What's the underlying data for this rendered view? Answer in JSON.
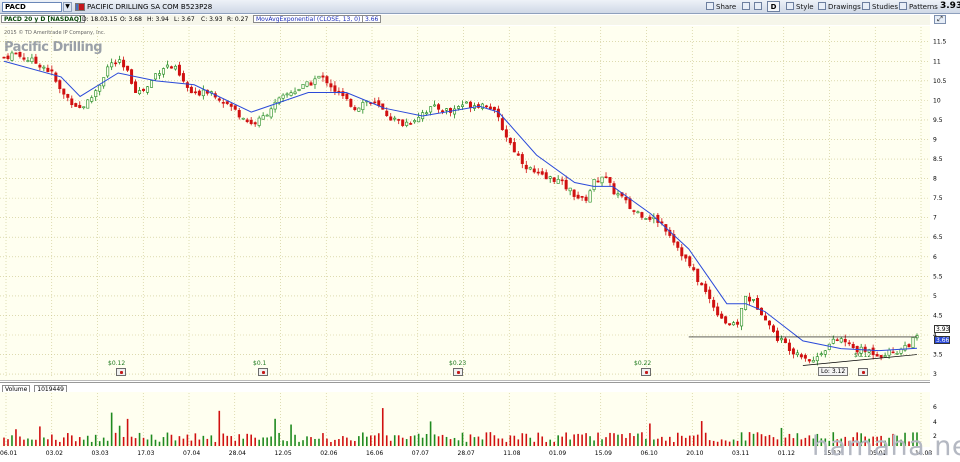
{
  "toolbar": {
    "symbol": "PACD",
    "dropdown_glyph": "▼",
    "description": "PACIFIC DRILLING SA COM  B523P28",
    "share": "Share",
    "d_button": "D",
    "style": "Style",
    "drawings": "Drawings",
    "studies": "Studies",
    "patterns": "Patterns",
    "last_price": "3.93",
    "icons": [
      "blue-square-icon",
      "red-square-icon",
      "share-icon",
      "grid-icon",
      "camera-icon",
      "style-icon",
      "drawings-icon",
      "studies-icon",
      "patterns-icon",
      "zoom-icon"
    ]
  },
  "quote": {
    "title": "PACD 20 y D [NASDAQ]",
    "date": "D: 18.03.15",
    "open": "O: 3.68",
    "high": "H: 3.94",
    "low": "L: 3.67",
    "close": "C: 3.93",
    "range": "R: 0.27",
    "study": "MovAvgExponential (CLOSE, 13, 0)",
    "study_value": "3.66"
  },
  "chart": {
    "copyright": "2015 © TD Ameritrade IP Company, Inc.",
    "logo": "Pacific Drilling",
    "low_label": "Lo: 3.12",
    "price_tag": "3.93",
    "ema_tag": "3.66",
    "colors": {
      "up": "#1f8a1f",
      "down": "#d01010",
      "ema": "#2b4ad9",
      "grid": "#c9c58a",
      "bg": "#fffff0"
    },
    "dividends": [
      {
        "label": "$0.12"
      },
      {
        "label": "$0.1"
      },
      {
        "label": "$0.23"
      },
      {
        "label": "$0.22"
      },
      {
        "label": "$0.12"
      }
    ]
  },
  "volume": {
    "title": "Volume",
    "value": "1019449",
    "scale": [
      "6",
      "4",
      "2"
    ]
  },
  "watermark": "hamaha.net",
  "chart_data": {
    "type": "candlestick",
    "title": "PACD 20 y D [NASDAQ]",
    "ylim": [
      2.9,
      11.8
    ],
    "y_ticks": [
      "11.5",
      "11",
      "10.5",
      "10",
      "9.5",
      "9",
      "8.5",
      "8",
      "7.5",
      "7",
      "6.5",
      "6",
      "5.5",
      "5",
      "4.5",
      "4",
      "3.5",
      "3"
    ],
    "x_ticks": [
      "06.01",
      "03.02",
      "03.03",
      "17.03",
      "07.04",
      "28.04",
      "12.05",
      "02.06",
      "16.06",
      "07.07",
      "28.07",
      "11.08",
      "01.09",
      "15.09",
      "06.10",
      "20.10",
      "03.11",
      "01.12",
      "15.12",
      "05.01",
      "16.03"
    ],
    "close_path": [
      [
        0,
        11.1
      ],
      [
        5,
        11.2
      ],
      [
        10,
        11.1
      ],
      [
        15,
        11.0
      ],
      [
        20,
        10.9
      ],
      [
        25,
        10.7
      ],
      [
        30,
        10.2
      ],
      [
        35,
        10.0
      ],
      [
        40,
        9.8
      ],
      [
        45,
        10.0
      ],
      [
        50,
        10.4
      ],
      [
        55,
        10.9
      ],
      [
        60,
        11.0
      ],
      [
        65,
        10.7
      ],
      [
        70,
        10.2
      ],
      [
        75,
        10.3
      ],
      [
        80,
        10.7
      ],
      [
        85,
        10.9
      ],
      [
        90,
        10.8
      ],
      [
        95,
        10.4
      ],
      [
        100,
        10.1
      ],
      [
        105,
        10.3
      ],
      [
        110,
        10.2
      ],
      [
        115,
        10.0
      ],
      [
        120,
        9.8
      ],
      [
        125,
        9.6
      ],
      [
        130,
        9.4
      ],
      [
        135,
        9.5
      ],
      [
        140,
        9.8
      ],
      [
        145,
        10.0
      ],
      [
        150,
        10.2
      ],
      [
        155,
        10.3
      ],
      [
        160,
        10.4
      ],
      [
        165,
        10.6
      ],
      [
        170,
        10.5
      ],
      [
        175,
        10.2
      ],
      [
        180,
        10.0
      ],
      [
        185,
        9.8
      ],
      [
        190,
        10.0
      ],
      [
        195,
        9.9
      ],
      [
        200,
        9.7
      ],
      [
        205,
        9.5
      ],
      [
        210,
        9.4
      ],
      [
        215,
        9.5
      ],
      [
        220,
        9.7
      ],
      [
        225,
        9.8
      ],
      [
        230,
        9.8
      ],
      [
        235,
        9.7
      ],
      [
        240,
        9.9
      ],
      [
        245,
        9.9
      ],
      [
        250,
        9.9
      ],
      [
        255,
        9.9
      ],
      [
        260,
        9.5
      ],
      [
        265,
        9.0
      ],
      [
        270,
        8.6
      ],
      [
        275,
        8.3
      ],
      [
        280,
        8.1
      ],
      [
        285,
        8.0
      ],
      [
        290,
        8.0
      ],
      [
        295,
        7.8
      ],
      [
        300,
        7.6
      ],
      [
        305,
        7.4
      ],
      [
        310,
        7.9
      ],
      [
        315,
        8.1
      ],
      [
        320,
        7.7
      ],
      [
        325,
        7.5
      ],
      [
        330,
        7.2
      ],
      [
        335,
        7.1
      ],
      [
        340,
        7.0
      ],
      [
        345,
        6.9
      ],
      [
        350,
        6.6
      ],
      [
        355,
        6.2
      ],
      [
        360,
        5.8
      ],
      [
        365,
        5.4
      ],
      [
        370,
        5.0
      ],
      [
        375,
        4.6
      ],
      [
        380,
        4.3
      ],
      [
        385,
        4.2
      ],
      [
        390,
        5.0
      ],
      [
        395,
        4.8
      ],
      [
        400,
        4.5
      ],
      [
        405,
        4.0
      ],
      [
        410,
        3.8
      ],
      [
        415,
        3.6
      ],
      [
        420,
        3.5
      ],
      [
        425,
        3.3
      ],
      [
        430,
        3.6
      ],
      [
        435,
        3.8
      ],
      [
        440,
        3.9
      ],
      [
        445,
        3.7
      ],
      [
        450,
        3.6
      ],
      [
        455,
        3.6
      ],
      [
        460,
        3.5
      ],
      [
        465,
        3.55
      ],
      [
        470,
        3.6
      ],
      [
        475,
        3.75
      ],
      [
        480,
        3.93
      ]
    ],
    "ema_path": [
      [
        0,
        11.0
      ],
      [
        30,
        10.6
      ],
      [
        40,
        10.1
      ],
      [
        60,
        10.7
      ],
      [
        80,
        10.5
      ],
      [
        100,
        10.4
      ],
      [
        130,
        9.7
      ],
      [
        160,
        10.2
      ],
      [
        180,
        10.2
      ],
      [
        200,
        9.8
      ],
      [
        220,
        9.6
      ],
      [
        250,
        9.85
      ],
      [
        260,
        9.7
      ],
      [
        280,
        8.6
      ],
      [
        300,
        7.9
      ],
      [
        310,
        7.8
      ],
      [
        320,
        7.8
      ],
      [
        340,
        7.1
      ],
      [
        360,
        6.2
      ],
      [
        380,
        4.8
      ],
      [
        390,
        4.8
      ],
      [
        400,
        4.6
      ],
      [
        420,
        3.85
      ],
      [
        440,
        3.65
      ],
      [
        460,
        3.6
      ],
      [
        480,
        3.66
      ]
    ]
  }
}
